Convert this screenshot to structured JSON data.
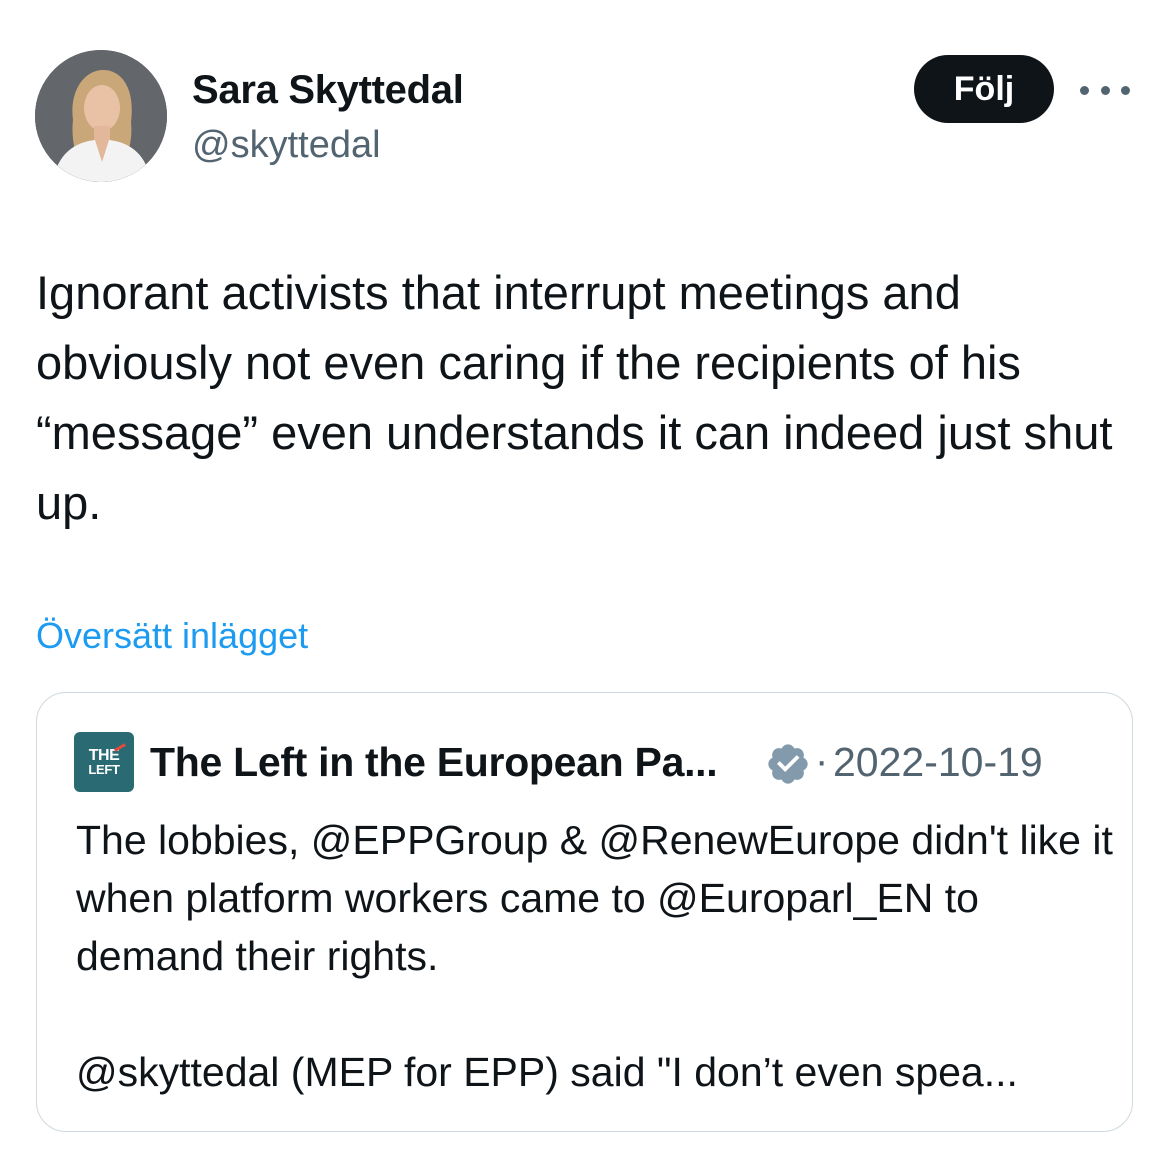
{
  "author": {
    "name": "Sara Skyttedal",
    "handle": "@skyttedal"
  },
  "actions": {
    "follow_label": "Följ",
    "more_icon": "more-dots-icon"
  },
  "tweet": {
    "text": "Ignorant activists that interrupt meetings and obviously not even caring if the recipients of his “message” even understands it can indeed just shut up.",
    "translate_label": "Översätt inlägget"
  },
  "quoted_tweet": {
    "avatar_line1": "THE",
    "avatar_line2": "LEFT",
    "author_name": "The Left in the European Pa...",
    "verified_icon": "verified-badge-icon",
    "separator": "·",
    "date": "2022-10-19",
    "text": "The lobbies, @EPPGroup & @RenewEurope didn't like it when platform workers came to @Europarl_EN to demand their rights.\n\n@skyttedal (MEP for EPP) said \"I don’t even spea..."
  },
  "colors": {
    "text_primary": "#0f1419",
    "text_secondary": "#536471",
    "link": "#1d9bf0",
    "follow_bg": "#0f1419",
    "border": "#cfd9de",
    "left_brand": "#2a6b73"
  }
}
